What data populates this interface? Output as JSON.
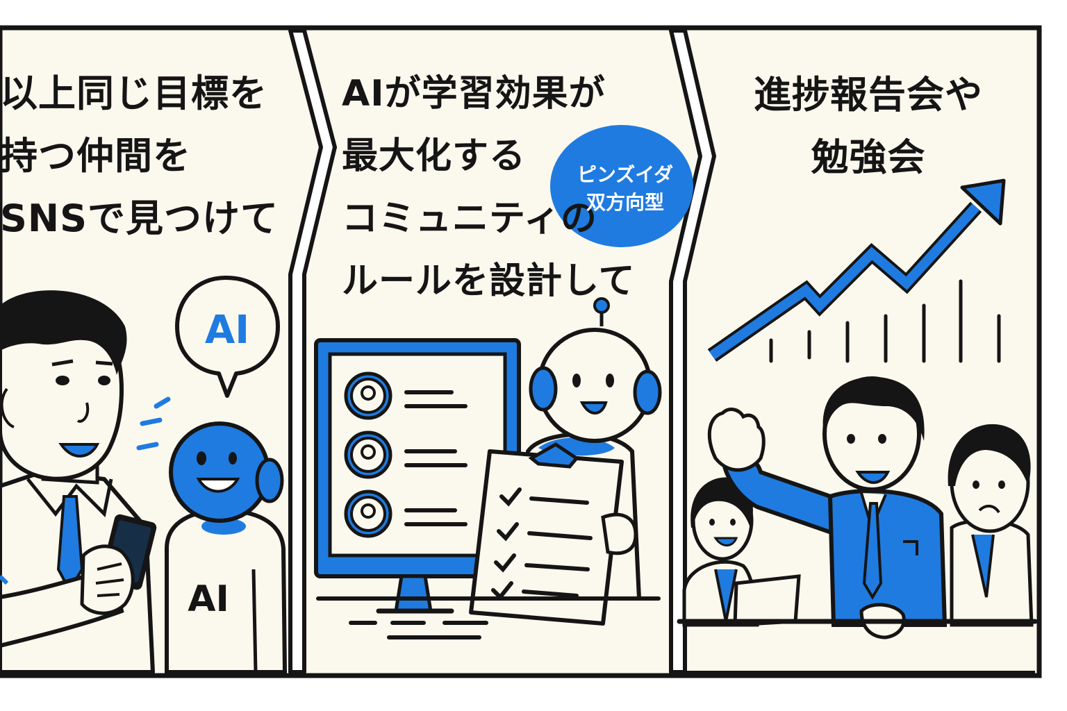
{
  "panels": [
    {
      "caption": [
        "以上同じ目標を",
        "持つ仲間を",
        "SNSで見つけて"
      ],
      "ai_speech": "AI",
      "robot_chest": "AI"
    },
    {
      "caption": [
        "AIが学習効果が",
        "最大化する",
        "コミュニティの",
        "ルールを設計して"
      ],
      "bubble": [
        "ピンズイダ",
        "双方向型"
      ]
    },
    {
      "caption": [
        "進捗報告会や",
        "勉強会"
      ]
    }
  ],
  "colors": {
    "accent": "#1f7be0",
    "ink": "#151515",
    "paper": "#fbf8ee"
  }
}
